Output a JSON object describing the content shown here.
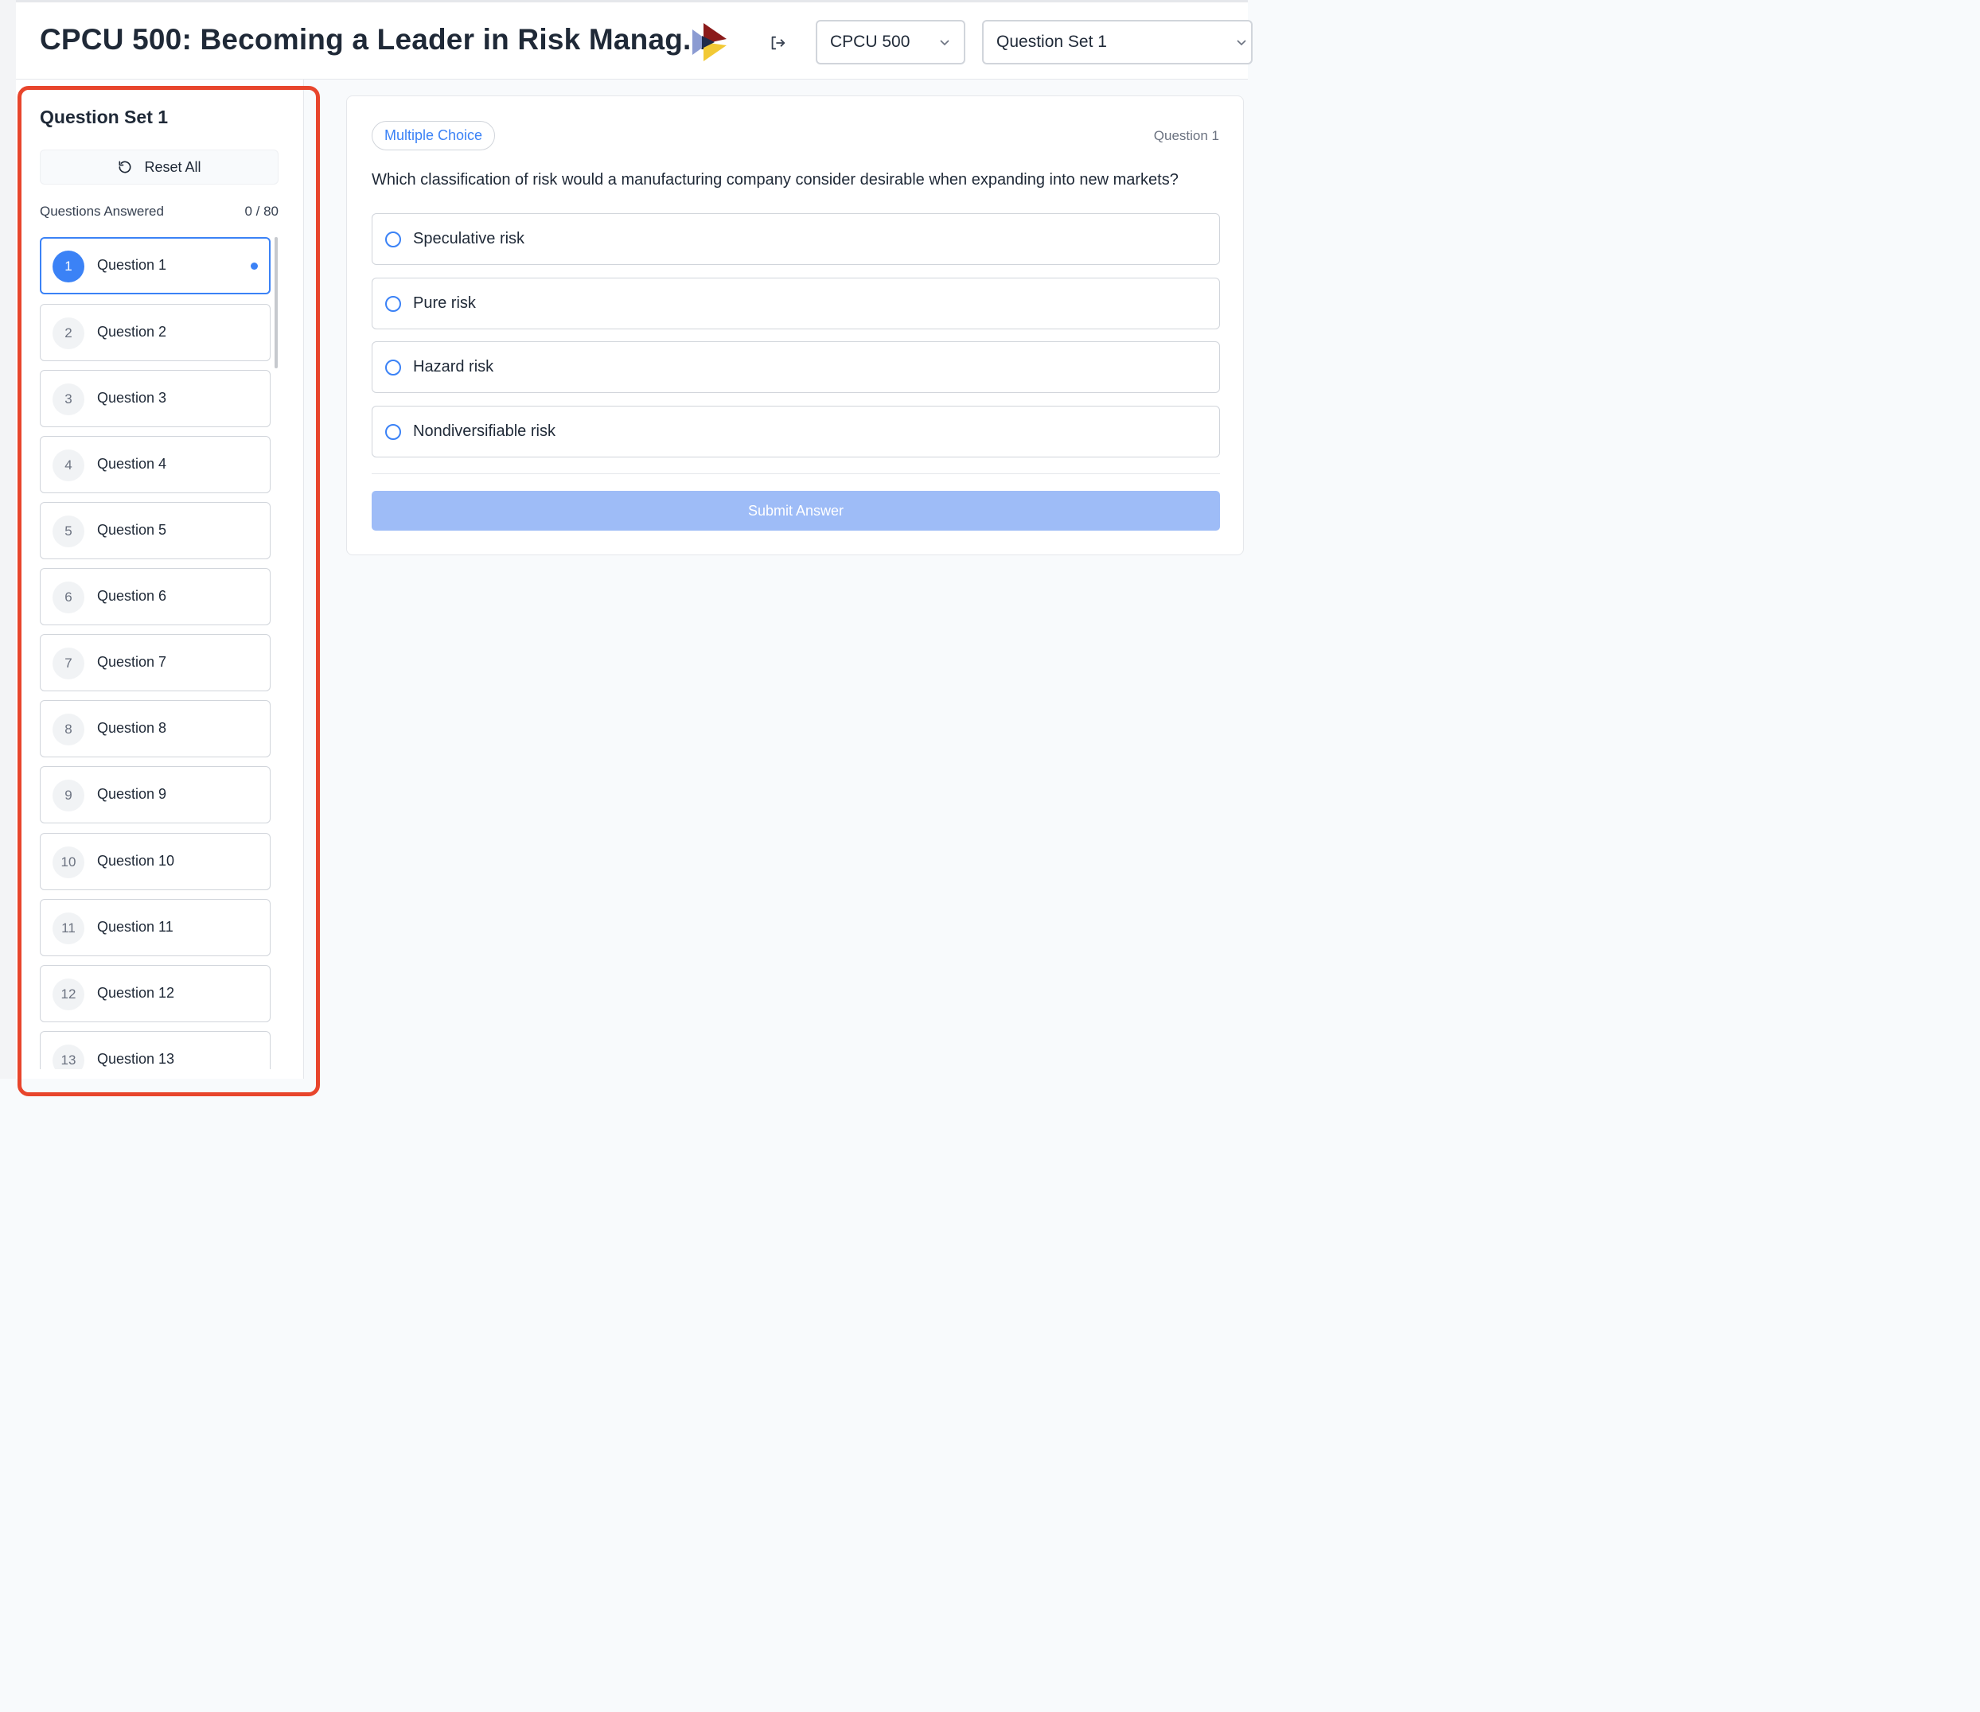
{
  "header": {
    "title": "CPCU 500: Becoming a Leader in Risk Manag...",
    "course_select": "CPCU 500",
    "set_select": "Question Set 1"
  },
  "sidebar": {
    "title": "Question Set 1",
    "reset_label": "Reset All",
    "answered_label": "Questions Answered",
    "answered_value": "0 / 80",
    "questions": [
      {
        "num": "1",
        "label": "Question 1"
      },
      {
        "num": "2",
        "label": "Question 2"
      },
      {
        "num": "3",
        "label": "Question 3"
      },
      {
        "num": "4",
        "label": "Question 4"
      },
      {
        "num": "5",
        "label": "Question 5"
      },
      {
        "num": "6",
        "label": "Question 6"
      },
      {
        "num": "7",
        "label": "Question 7"
      },
      {
        "num": "8",
        "label": "Question 8"
      },
      {
        "num": "9",
        "label": "Question 9"
      },
      {
        "num": "10",
        "label": "Question 10"
      },
      {
        "num": "11",
        "label": "Question 11"
      },
      {
        "num": "12",
        "label": "Question 12"
      },
      {
        "num": "13",
        "label": "Question 13"
      }
    ]
  },
  "question": {
    "type": "Multiple Choice",
    "counter": "Question 1",
    "text": "Which classification of risk would a manufacturing company consider desirable when expanding into new markets?",
    "options": [
      "Speculative risk",
      "Pure risk",
      "Hazard risk",
      "Nondiversifiable risk"
    ],
    "submit_label": "Submit Answer"
  },
  "colors": {
    "accent": "#3b82f6",
    "submit_disabled": "#9ebcf7",
    "highlight_box": "#e8452c"
  },
  "icons": {
    "logo": "play-triangle-logo-icon",
    "logout": "logout-icon",
    "chevron": "chevron-down-icon",
    "reset": "reset-icon"
  }
}
